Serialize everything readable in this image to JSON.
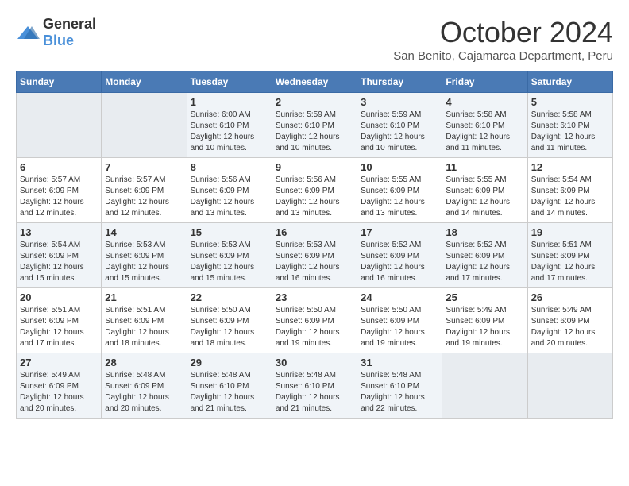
{
  "header": {
    "logo_general": "General",
    "logo_blue": "Blue",
    "month": "October 2024",
    "location": "San Benito, Cajamarca Department, Peru"
  },
  "weekdays": [
    "Sunday",
    "Monday",
    "Tuesday",
    "Wednesday",
    "Thursday",
    "Friday",
    "Saturday"
  ],
  "weeks": [
    [
      {
        "day": "",
        "info": ""
      },
      {
        "day": "",
        "info": ""
      },
      {
        "day": "1",
        "info": "Sunrise: 6:00 AM\nSunset: 6:10 PM\nDaylight: 12 hours and 10 minutes."
      },
      {
        "day": "2",
        "info": "Sunrise: 5:59 AM\nSunset: 6:10 PM\nDaylight: 12 hours and 10 minutes."
      },
      {
        "day": "3",
        "info": "Sunrise: 5:59 AM\nSunset: 6:10 PM\nDaylight: 12 hours and 10 minutes."
      },
      {
        "day": "4",
        "info": "Sunrise: 5:58 AM\nSunset: 6:10 PM\nDaylight: 12 hours and 11 minutes."
      },
      {
        "day": "5",
        "info": "Sunrise: 5:58 AM\nSunset: 6:10 PM\nDaylight: 12 hours and 11 minutes."
      }
    ],
    [
      {
        "day": "6",
        "info": "Sunrise: 5:57 AM\nSunset: 6:09 PM\nDaylight: 12 hours and 12 minutes."
      },
      {
        "day": "7",
        "info": "Sunrise: 5:57 AM\nSunset: 6:09 PM\nDaylight: 12 hours and 12 minutes."
      },
      {
        "day": "8",
        "info": "Sunrise: 5:56 AM\nSunset: 6:09 PM\nDaylight: 12 hours and 13 minutes."
      },
      {
        "day": "9",
        "info": "Sunrise: 5:56 AM\nSunset: 6:09 PM\nDaylight: 12 hours and 13 minutes."
      },
      {
        "day": "10",
        "info": "Sunrise: 5:55 AM\nSunset: 6:09 PM\nDaylight: 12 hours and 13 minutes."
      },
      {
        "day": "11",
        "info": "Sunrise: 5:55 AM\nSunset: 6:09 PM\nDaylight: 12 hours and 14 minutes."
      },
      {
        "day": "12",
        "info": "Sunrise: 5:54 AM\nSunset: 6:09 PM\nDaylight: 12 hours and 14 minutes."
      }
    ],
    [
      {
        "day": "13",
        "info": "Sunrise: 5:54 AM\nSunset: 6:09 PM\nDaylight: 12 hours and 15 minutes."
      },
      {
        "day": "14",
        "info": "Sunrise: 5:53 AM\nSunset: 6:09 PM\nDaylight: 12 hours and 15 minutes."
      },
      {
        "day": "15",
        "info": "Sunrise: 5:53 AM\nSunset: 6:09 PM\nDaylight: 12 hours and 15 minutes."
      },
      {
        "day": "16",
        "info": "Sunrise: 5:53 AM\nSunset: 6:09 PM\nDaylight: 12 hours and 16 minutes."
      },
      {
        "day": "17",
        "info": "Sunrise: 5:52 AM\nSunset: 6:09 PM\nDaylight: 12 hours and 16 minutes."
      },
      {
        "day": "18",
        "info": "Sunrise: 5:52 AM\nSunset: 6:09 PM\nDaylight: 12 hours and 17 minutes."
      },
      {
        "day": "19",
        "info": "Sunrise: 5:51 AM\nSunset: 6:09 PM\nDaylight: 12 hours and 17 minutes."
      }
    ],
    [
      {
        "day": "20",
        "info": "Sunrise: 5:51 AM\nSunset: 6:09 PM\nDaylight: 12 hours and 17 minutes."
      },
      {
        "day": "21",
        "info": "Sunrise: 5:51 AM\nSunset: 6:09 PM\nDaylight: 12 hours and 18 minutes."
      },
      {
        "day": "22",
        "info": "Sunrise: 5:50 AM\nSunset: 6:09 PM\nDaylight: 12 hours and 18 minutes."
      },
      {
        "day": "23",
        "info": "Sunrise: 5:50 AM\nSunset: 6:09 PM\nDaylight: 12 hours and 19 minutes."
      },
      {
        "day": "24",
        "info": "Sunrise: 5:50 AM\nSunset: 6:09 PM\nDaylight: 12 hours and 19 minutes."
      },
      {
        "day": "25",
        "info": "Sunrise: 5:49 AM\nSunset: 6:09 PM\nDaylight: 12 hours and 19 minutes."
      },
      {
        "day": "26",
        "info": "Sunrise: 5:49 AM\nSunset: 6:09 PM\nDaylight: 12 hours and 20 minutes."
      }
    ],
    [
      {
        "day": "27",
        "info": "Sunrise: 5:49 AM\nSunset: 6:09 PM\nDaylight: 12 hours and 20 minutes."
      },
      {
        "day": "28",
        "info": "Sunrise: 5:48 AM\nSunset: 6:09 PM\nDaylight: 12 hours and 20 minutes."
      },
      {
        "day": "29",
        "info": "Sunrise: 5:48 AM\nSunset: 6:10 PM\nDaylight: 12 hours and 21 minutes."
      },
      {
        "day": "30",
        "info": "Sunrise: 5:48 AM\nSunset: 6:10 PM\nDaylight: 12 hours and 21 minutes."
      },
      {
        "day": "31",
        "info": "Sunrise: 5:48 AM\nSunset: 6:10 PM\nDaylight: 12 hours and 22 minutes."
      },
      {
        "day": "",
        "info": ""
      },
      {
        "day": "",
        "info": ""
      }
    ]
  ]
}
